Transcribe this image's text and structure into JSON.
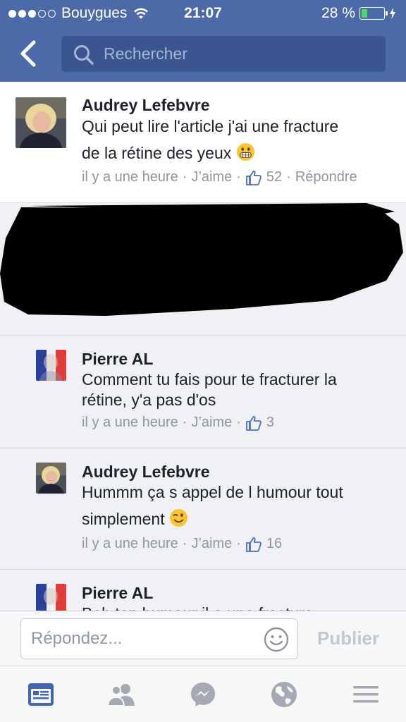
{
  "status_bar": {
    "carrier": "Bouygues",
    "time": "21:07",
    "battery": "28 %",
    "battery_level": 0.28
  },
  "search": {
    "placeholder": "Rechercher",
    "icon": "search-icon"
  },
  "comments": [
    {
      "name": "Audrey Lefebvre",
      "text_line1": "Qui peut lire l'article j'ai une fracture",
      "text_line2": "de la rétine des yeux",
      "emoji": "grimacing-emoji",
      "time": "il y a une heure",
      "like": "J’aime",
      "likes": "52",
      "reply": "Répondre"
    },
    {
      "name": "Pierre AL",
      "text_line1": "Comment tu fais pour te fracturer la",
      "text_line2": "rétine, y'a pas d'os",
      "time": "il y a une heure",
      "like": "J’aime",
      "likes": "3"
    },
    {
      "name": "Audrey Lefebvre",
      "text_line1": "Hummm ça s appel de l humour tout",
      "text_line2": "simplement",
      "emoji": "winking-emoji",
      "time": "il y a une heure",
      "like": "J’aime",
      "likes": "16"
    },
    {
      "name": "Pierre AL",
      "text_line1": "Bah ton humour il a une fracture"
    }
  ],
  "compose": {
    "placeholder": "Répondez...",
    "publish": "Publier"
  },
  "tabs": [
    "news-feed-icon",
    "friends-icon",
    "messenger-icon",
    "globe-icon",
    "menu-icon"
  ],
  "colors": {
    "header": "#4d6aa8",
    "active_tab": "#4267b2",
    "inactive_tab": "#a4a9b3"
  }
}
